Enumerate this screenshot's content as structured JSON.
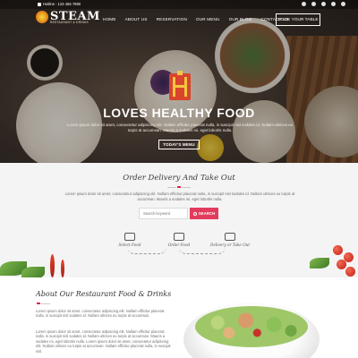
{
  "topbar": {
    "hotline": "Hotline : 123 456 7890",
    "social_icons": [
      "facebook-icon",
      "twitter-icon",
      "google-plus-icon",
      "linkedin-icon",
      "pinterest-icon"
    ]
  },
  "logo": {
    "name": "STEAM",
    "tagline": "RESTAURANT & DRINKS"
  },
  "nav": {
    "items": [
      "HOME",
      "ABOUT US",
      "RESERVATION",
      "OUR MENU",
      "OUR BLOG",
      "CONTACT US"
    ],
    "book_label": "BOOK YOUR TABLE"
  },
  "hero": {
    "title": "LOVES HEALTHY FOOD",
    "text": "Lorem ipsum dolor sit amet, consectetur adipiscing elit. Nullam efficitur placerat nulla, in suscipit nisl sodales id. Nullam ultrices eu turpis at accumsan. Mauris a sodales mi, eget lobortis nulla.",
    "button_label": "TODAY'S MENU"
  },
  "order": {
    "title": "Order Delivery And Take Out",
    "text": "Lorem ipsum dolor sit amet, consectetur adipiscing elit. Nullam efficitur placerat nulla, in suscipit nisl sodales id. Nullam ultrices eu turpis at accumsan. Mauris a sodales mi, eget lobortis nulla.",
    "search_placeholder": "Search keyword",
    "search_button": "SEARCH",
    "steps": [
      "Select Food",
      "Order Food",
      "Delivery or Take Out"
    ]
  },
  "about": {
    "title": "About Our Restaurant Food & Drinks",
    "paragraph1": "Lorem ipsum dolor sit amet, consectetur adipiscing elit. Nullam efficitur placerat nulla, in suscipit nisl sodales id. Nullam ultrices eu turpis at accumsan.",
    "paragraph2": "Lorem ipsum dolor sit amet, consectetur adipiscing elit. Nullam efficitur placerat nulla, in suscipit nisl sodales id. Nullam ultrices eu turpis at accumsan. Mauris a sodales mi, eget lobortis nulla. Lorem ipsum dolor sit amet, consectetur adipiscing elit. Nullam ultrices eu turpis at accumsan. Nullam efficitur placerat nulla, in suscipit nisl."
  },
  "colors": {
    "accent": "#e23c5d",
    "logo_orange": "#e48a1c"
  }
}
